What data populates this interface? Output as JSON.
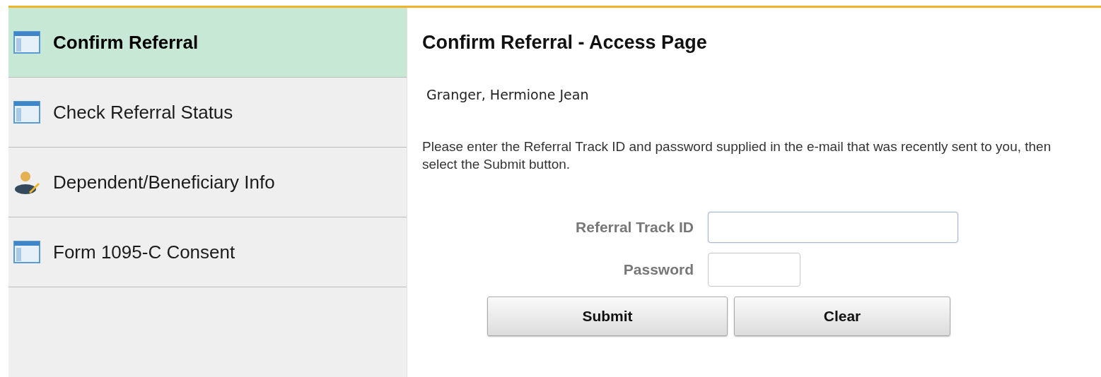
{
  "sidebar": {
    "items": [
      {
        "label": "Confirm Referral",
        "kind": "page",
        "selected": true
      },
      {
        "label": "Check Referral Status",
        "kind": "page",
        "selected": false
      },
      {
        "label": "Dependent/Beneficiary Info",
        "kind": "person",
        "selected": false
      },
      {
        "label": "Form 1095-C Consent",
        "kind": "page",
        "selected": false
      }
    ]
  },
  "page": {
    "title": "Confirm Referral - Access Page",
    "name": "Granger, Hermione Jean",
    "instructions": "Please enter the Referral Track ID and password supplied in the e-mail that was recently sent to you, then select the Submit button.",
    "fields": [
      {
        "label": "Referral Track ID",
        "kind": "long",
        "focused": true
      },
      {
        "label": "Password",
        "kind": "short",
        "focused": false
      }
    ],
    "buttons": [
      "Submit",
      "Clear"
    ]
  }
}
